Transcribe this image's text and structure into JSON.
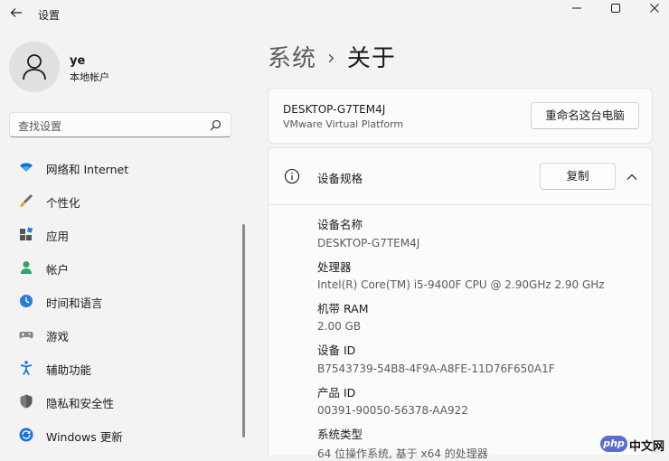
{
  "window": {
    "title": "设置"
  },
  "profile": {
    "name": "ye",
    "account_type": "本地帐户"
  },
  "search": {
    "placeholder": "查找设置"
  },
  "nav": {
    "items": [
      {
        "label": "网络和 Internet",
        "icon": "wifi-icon"
      },
      {
        "label": "个性化",
        "icon": "brush-icon"
      },
      {
        "label": "应用",
        "icon": "apps-icon"
      },
      {
        "label": "帐户",
        "icon": "person-icon"
      },
      {
        "label": "时间和语言",
        "icon": "globe-clock-icon"
      },
      {
        "label": "游戏",
        "icon": "gamepad-icon"
      },
      {
        "label": "辅助功能",
        "icon": "accessibility-icon"
      },
      {
        "label": "隐私和安全性",
        "icon": "shield-icon"
      },
      {
        "label": "Windows 更新",
        "icon": "update-icon"
      }
    ]
  },
  "breadcrumb": {
    "parent": "系统",
    "separator": "›",
    "current": "关于"
  },
  "device": {
    "name": "DESKTOP-G7TEM4J",
    "model": "VMware Virtual Platform",
    "rename_label": "重命名这台电脑"
  },
  "specs": {
    "title": "设备规格",
    "copy_label": "复制",
    "rows": [
      {
        "label": "设备名称",
        "value": "DESKTOP-G7TEM4J"
      },
      {
        "label": "处理器",
        "value": "Intel(R) Core(TM) i5-9400F CPU @ 2.90GHz   2.90 GHz"
      },
      {
        "label": "机带 RAM",
        "value": "2.00 GB"
      },
      {
        "label": "设备 ID",
        "value": "B7543739-54B8-4F9A-A8FE-11D76F650A1F"
      },
      {
        "label": "产品 ID",
        "value": "00391-90050-56378-AA922"
      },
      {
        "label": "系统类型",
        "value": "64 位操作系统, 基于 x64 的处理器"
      }
    ]
  },
  "watermark": {
    "logo": "php",
    "text": "中文网"
  },
  "colors": {
    "accent": "#0067c0",
    "background": "#f3f3f3",
    "card": "#fbfbfb"
  }
}
